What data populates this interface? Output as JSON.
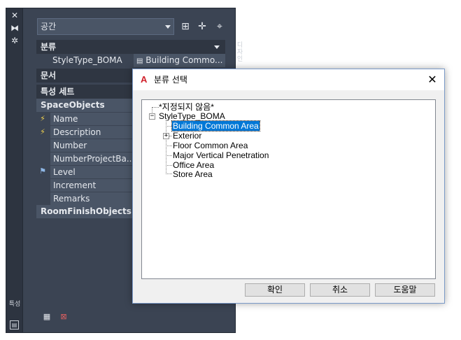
{
  "palette": {
    "strip_label": "특성",
    "dropdown_value": "공간",
    "side_tab": "디자인",
    "sections": {
      "classification": "분류",
      "document": "문서",
      "property_sets": "특성 세트"
    },
    "classification_row": {
      "label": "StyleType_BOMA",
      "value": "Building Commo..."
    },
    "groups": [
      "SpaceObjects",
      "RoomFinishObjects"
    ],
    "properties": [
      "Name",
      "Description",
      "Number",
      "NumberProjectBa...",
      "Level",
      "Increment",
      "Remarks"
    ]
  },
  "dialog": {
    "title": "분류 선택",
    "close": "✕",
    "tree": {
      "unspecified": "*지정되지 않음*",
      "root": "StyleType_BOMA",
      "children": [
        "Building Common Area",
        "Exterior",
        "Floor Common Area",
        "Major Vertical Penetration",
        "Office Area",
        "Store Area"
      ]
    },
    "buttons": {
      "ok": "확인",
      "cancel": "취소",
      "help": "도움말"
    }
  }
}
